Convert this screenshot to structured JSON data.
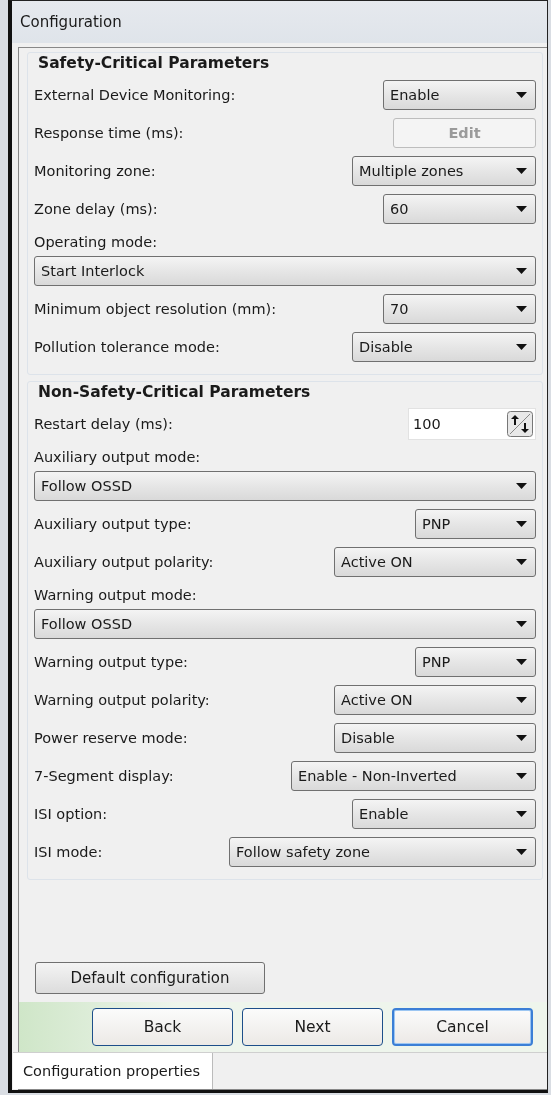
{
  "window": {
    "title": "Configuration"
  },
  "groups": [
    {
      "title": "Safety-Critical Parameters",
      "rows": [
        {
          "kind": "select",
          "label": "External Device Monitoring:",
          "value": "Enable"
        },
        {
          "kind": "button",
          "label": "Response time (ms):",
          "button": "Edit",
          "disabled": true
        },
        {
          "kind": "select",
          "label": "Monitoring zone:",
          "value": "Multiple zones"
        },
        {
          "kind": "select",
          "label": "Zone delay (ms):",
          "value": "60"
        },
        {
          "kind": "wide",
          "label": "Operating mode:",
          "value": "Start Interlock"
        },
        {
          "kind": "select",
          "label": "Minimum object resolution (mm):",
          "value": "70"
        },
        {
          "kind": "select",
          "label": "Pollution tolerance mode:",
          "value": "Disable"
        }
      ]
    },
    {
      "title": "Non-Safety-Critical Parameters",
      "rows": [
        {
          "kind": "spin",
          "label": "Restart delay (ms):",
          "value": "100"
        },
        {
          "kind": "wide",
          "label": "Auxiliary output mode:",
          "value": "Follow OSSD"
        },
        {
          "kind": "select",
          "label": "Auxiliary output type:",
          "value": "PNP"
        },
        {
          "kind": "select",
          "label": "Auxiliary output polarity:",
          "value": "Active ON"
        },
        {
          "kind": "wide",
          "label": "Warning output mode:",
          "value": "Follow OSSD"
        },
        {
          "kind": "select",
          "label": "Warning output type:",
          "value": "PNP"
        },
        {
          "kind": "select",
          "label": "Warning output polarity:",
          "value": "Active ON"
        },
        {
          "kind": "select",
          "label": "Power reserve mode:",
          "value": "Disable"
        },
        {
          "kind": "select",
          "label": "7-Segment display:",
          "value": "Enable - Non-Inverted"
        },
        {
          "kind": "select",
          "label": "ISI option:",
          "value": "Enable"
        },
        {
          "kind": "select",
          "label": "ISI mode:",
          "value": "Follow safety zone"
        }
      ]
    }
  ],
  "default_button": "Default configuration",
  "nav_buttons": [
    {
      "label": "Back",
      "focused": false
    },
    {
      "label": "Next",
      "focused": false
    },
    {
      "label": "Cancel",
      "focused": true
    }
  ],
  "status_bar": [
    "Configuration properties"
  ]
}
